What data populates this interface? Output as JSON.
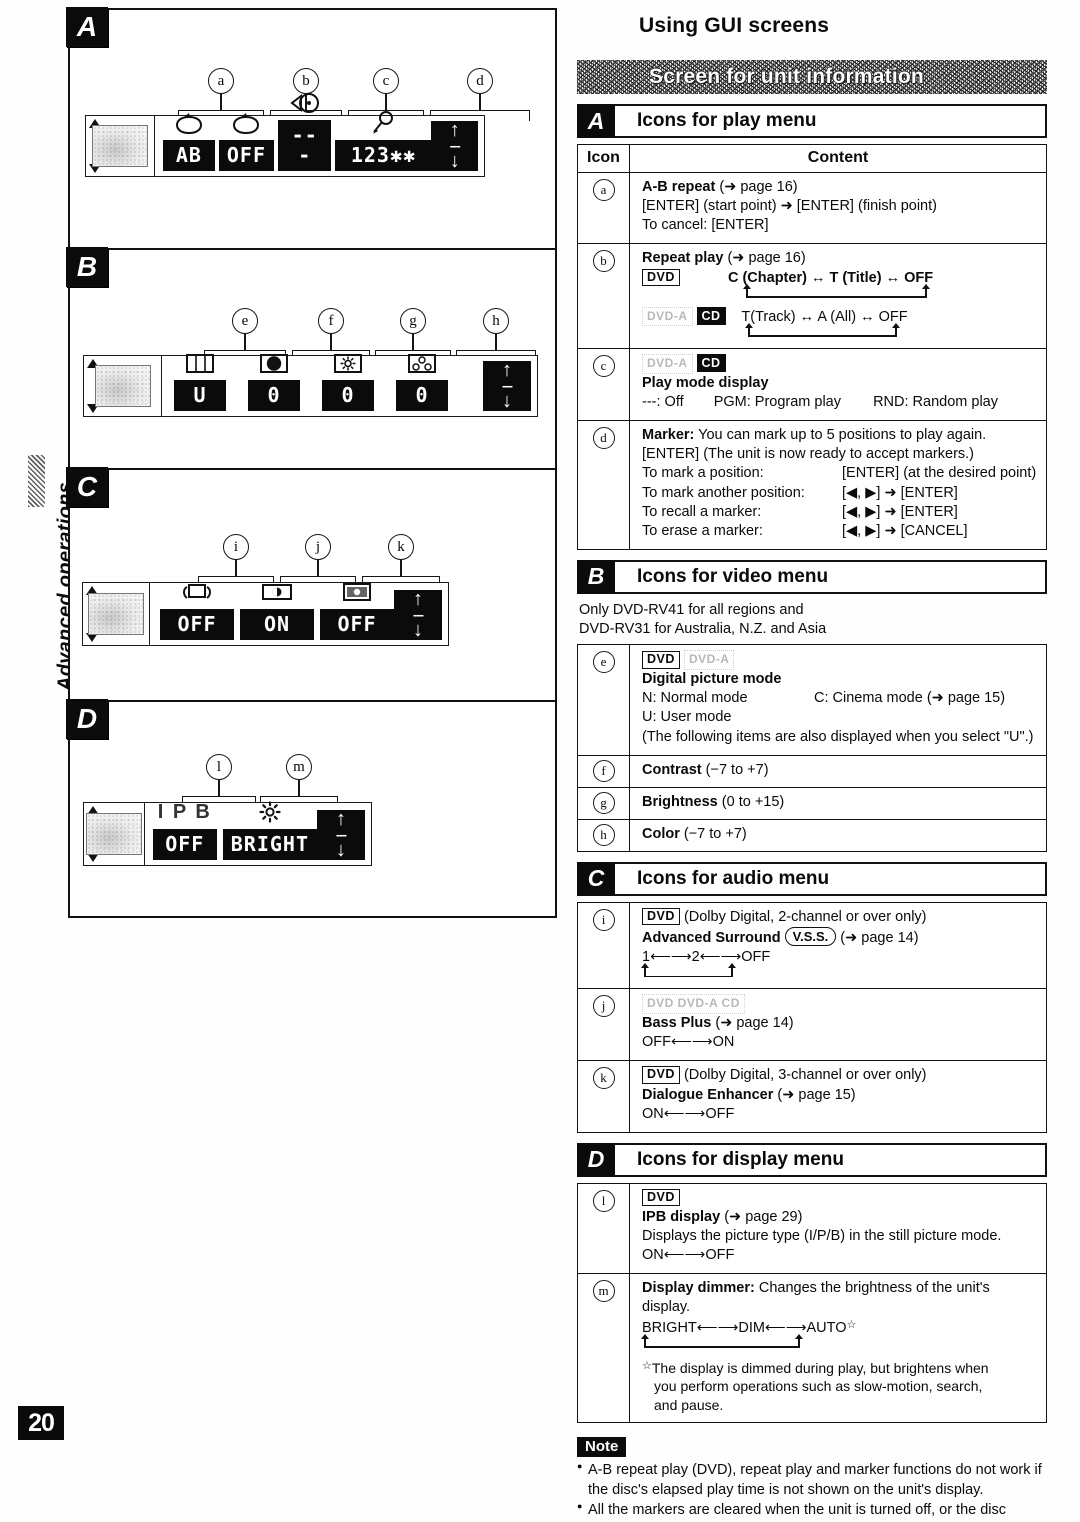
{
  "sidebar": {
    "chapter_label": "Advanced operations"
  },
  "page_number": "20",
  "header": {
    "title": "Using GUI screens",
    "banner": "Screen for unit information"
  },
  "sections": [
    {
      "badge": "A",
      "title": "Icons for play menu"
    },
    {
      "badge": "B",
      "title": "Icons for video menu"
    },
    {
      "badge": "C",
      "title": "Icons for audio menu"
    },
    {
      "badge": "D",
      "title": "Icons for display menu"
    }
  ],
  "table_a": {
    "col_icon": "Icon",
    "col_content": "Content",
    "rows": {
      "a": {
        "key": "a",
        "title": "A-B repeat",
        "ref": "(➜ page 16)",
        "line2": "[ENTER]  (start point) ➜ [ENTER]  (finish point)",
        "line3": "To cancel: [ENTER]"
      },
      "b": {
        "key": "b",
        "title": "Repeat play",
        "ref": "(➜ page 16)",
        "dvd_badge": "DVD",
        "dvd_chain": "C (Chapter) ↔ T (Title) ↔ OFF",
        "cd_ghost": "DVD-A",
        "cd_badge": "CD",
        "cd_chain": "T(Track) ↔ A (All) ↔ OFF"
      },
      "c": {
        "key": "c",
        "ghost": "DVD-A",
        "cd_badge": "CD",
        "title": "Play mode display",
        "opt1": "---: Off",
        "opt2": "PGM: Program play",
        "opt3": "RND: Random play"
      },
      "d": {
        "key": "d",
        "title": "Marker:",
        "title_rest": " You can mark up to 5 positions to play again.",
        "line2": "[ENTER]  (The unit is now ready to accept markers.)",
        "pairs": [
          {
            "label": "To mark a position:",
            "action": "[ENTER] (at the desired point)"
          },
          {
            "label": "To mark another position:",
            "action": "[◀, ▶] ➜ [ENTER]"
          },
          {
            "label": "To recall a marker:",
            "action": "[◀, ▶] ➜ [ENTER]"
          },
          {
            "label": "To erase a marker:",
            "action": "[◀, ▶] ➜ [CANCEL]"
          }
        ]
      }
    }
  },
  "table_b": {
    "region_note_1": "Only DVD-RV41 for all regions and",
    "region_note_2": "DVD-RV31 for Australia, N.Z. and Asia",
    "rows": {
      "e": {
        "key": "e",
        "dvd_badge": "DVD",
        "ghost": "DVD-A",
        "title": "Digital picture mode",
        "n_mode": "N: Normal mode",
        "c_mode": "C: Cinema mode (➜ page 15)",
        "u_mode": "U: User mode",
        "paren": "(The following items are also displayed when you select \"U\".)"
      },
      "f": {
        "key": "f",
        "title": "Contrast",
        "range": "(−7 to +7)"
      },
      "g": {
        "key": "g",
        "title": "Brightness",
        "range": "(0 to +15)"
      },
      "h": {
        "key": "h",
        "title": "Color",
        "range": "(−7 to +7)"
      }
    }
  },
  "table_c": {
    "rows": {
      "i": {
        "key": "i",
        "dvd_badge": "DVD",
        "cond": "(Dolby Digital, 2-channel or over only)",
        "title": "Advanced Surround",
        "vss": "V.S.S.",
        "ref": "(➜ page 14)",
        "chain": "1⟵⟶2⟵⟶OFF"
      },
      "j": {
        "key": "j",
        "ghost": "DVD   DVD-A   CD",
        "title": "Bass Plus",
        "ref": "(➜ page 14)",
        "chain": "OFF⟵⟶ON"
      },
      "k": {
        "key": "k",
        "dvd_badge": "DVD",
        "cond": "(Dolby Digital, 3-channel or over only)",
        "title": "Dialogue Enhancer",
        "ref": "(➜ page 15)",
        "chain": "ON⟵⟶OFF"
      }
    }
  },
  "table_d": {
    "rows": {
      "l": {
        "key": "l",
        "dvd_badge": "DVD",
        "title": "IPB display",
        "ref": "(➜ page 29)",
        "desc": "Displays the picture type (I/P/B) in the still picture mode.",
        "chain": "ON⟵⟶OFF"
      },
      "m": {
        "key": "m",
        "title": "Display dimmer:",
        "title_rest": " Changes the brightness of the unit's",
        "line2": "display.",
        "chain": "BRIGHT⟵⟶DIM⟵⟶AUTO",
        "footnote_1": "The display is dimmed during play, but brightens when",
        "footnote_2": "you perform operations such as slow-motion, search,",
        "footnote_3": "and pause."
      }
    }
  },
  "note": {
    "label": "Note",
    "items": [
      "A-B repeat play (DVD), repeat play and marker functions do not work if the disc's elapsed play time is not shown on the unit's display.",
      "All the markers are cleared when the unit is turned off, or the disc"
    ]
  },
  "diagrams": {
    "A": {
      "badge": "A",
      "callouts": [
        "a",
        "b",
        "c",
        "d"
      ],
      "items": [
        {
          "icon": "repeat-ab-icon",
          "value": "AB"
        },
        {
          "icon": "repeat-play-icon",
          "value": "OFF"
        },
        {
          "icon": "play-mode-disc-icon",
          "value": "---"
        },
        {
          "icon": "marker-pin-icon",
          "value": "123✱✱"
        }
      ],
      "nav": {
        "up": "↑",
        "mid": "---",
        "down": "↓"
      }
    },
    "B": {
      "badge": "B",
      "callouts": [
        "e",
        "f",
        "g",
        "h"
      ],
      "items": [
        {
          "icon": "picture-mode-icon",
          "value": "U"
        },
        {
          "icon": "contrast-icon",
          "value": "0"
        },
        {
          "icon": "brightness-icon",
          "value": "0"
        },
        {
          "icon": "color-icon",
          "value": "0"
        }
      ],
      "nav": {
        "up": "↑",
        "mid": "---",
        "down": "↓"
      }
    },
    "C": {
      "badge": "C",
      "callouts": [
        "i",
        "j",
        "k"
      ],
      "items": [
        {
          "icon": "advanced-surround-icon",
          "value": "OFF"
        },
        {
          "icon": "bass-plus-icon",
          "value": "ON"
        },
        {
          "icon": "dialogue-enhancer-icon",
          "value": "OFF"
        }
      ],
      "nav": {
        "up": "↑",
        "mid": "---",
        "down": "↓"
      }
    },
    "D": {
      "badge": "D",
      "callouts": [
        "l",
        "m"
      ],
      "items": [
        {
          "icon": "ipb-icon",
          "value": "OFF",
          "label": "I P B"
        },
        {
          "icon": "dimmer-sun-icon",
          "value": "BRIGHT"
        }
      ],
      "nav": {
        "up": "↑",
        "mid": "---",
        "down": "↓"
      }
    }
  }
}
